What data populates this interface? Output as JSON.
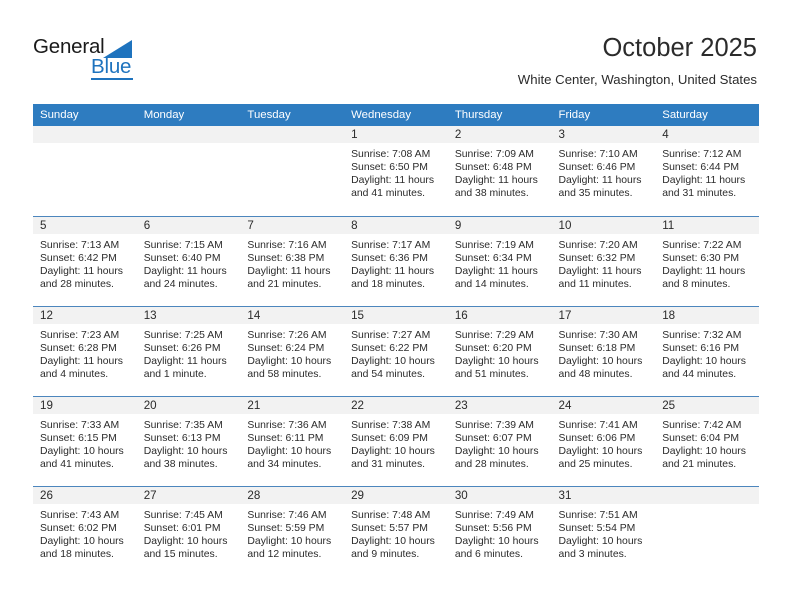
{
  "logo": {
    "word_one": "General",
    "word_two": "Blue",
    "triangle_color": "#1e73be"
  },
  "header": {
    "title": "October 2025",
    "subtitle": "White Center, Washington, United States",
    "accent_color": "#2e7cc0",
    "day_band_color": "#f2f2f2",
    "grid_rule_color": "#4c86bd"
  },
  "calendar": {
    "weekday_headers": [
      "Sunday",
      "Monday",
      "Tuesday",
      "Wednesday",
      "Thursday",
      "Friday",
      "Saturday"
    ],
    "labels": {
      "sunrise": "Sunrise:",
      "sunset": "Sunset:",
      "daylight": "Daylight:"
    },
    "weeks": [
      [
        {
          "day": "",
          "sunrise": "",
          "sunset": "",
          "daylight": "",
          "empty": true
        },
        {
          "day": "",
          "sunrise": "",
          "sunset": "",
          "daylight": "",
          "empty": true
        },
        {
          "day": "",
          "sunrise": "",
          "sunset": "",
          "daylight": "",
          "empty": true
        },
        {
          "day": "1",
          "sunrise": "Sunrise: 7:08 AM",
          "sunset": "Sunset: 6:50 PM",
          "daylight": "Daylight: 11 hours and 41 minutes."
        },
        {
          "day": "2",
          "sunrise": "Sunrise: 7:09 AM",
          "sunset": "Sunset: 6:48 PM",
          "daylight": "Daylight: 11 hours and 38 minutes."
        },
        {
          "day": "3",
          "sunrise": "Sunrise: 7:10 AM",
          "sunset": "Sunset: 6:46 PM",
          "daylight": "Daylight: 11 hours and 35 minutes."
        },
        {
          "day": "4",
          "sunrise": "Sunrise: 7:12 AM",
          "sunset": "Sunset: 6:44 PM",
          "daylight": "Daylight: 11 hours and 31 minutes."
        }
      ],
      [
        {
          "day": "5",
          "sunrise": "Sunrise: 7:13 AM",
          "sunset": "Sunset: 6:42 PM",
          "daylight": "Daylight: 11 hours and 28 minutes."
        },
        {
          "day": "6",
          "sunrise": "Sunrise: 7:15 AM",
          "sunset": "Sunset: 6:40 PM",
          "daylight": "Daylight: 11 hours and 24 minutes."
        },
        {
          "day": "7",
          "sunrise": "Sunrise: 7:16 AM",
          "sunset": "Sunset: 6:38 PM",
          "daylight": "Daylight: 11 hours and 21 minutes."
        },
        {
          "day": "8",
          "sunrise": "Sunrise: 7:17 AM",
          "sunset": "Sunset: 6:36 PM",
          "daylight": "Daylight: 11 hours and 18 minutes."
        },
        {
          "day": "9",
          "sunrise": "Sunrise: 7:19 AM",
          "sunset": "Sunset: 6:34 PM",
          "daylight": "Daylight: 11 hours and 14 minutes."
        },
        {
          "day": "10",
          "sunrise": "Sunrise: 7:20 AM",
          "sunset": "Sunset: 6:32 PM",
          "daylight": "Daylight: 11 hours and 11 minutes."
        },
        {
          "day": "11",
          "sunrise": "Sunrise: 7:22 AM",
          "sunset": "Sunset: 6:30 PM",
          "daylight": "Daylight: 11 hours and 8 minutes."
        }
      ],
      [
        {
          "day": "12",
          "sunrise": "Sunrise: 7:23 AM",
          "sunset": "Sunset: 6:28 PM",
          "daylight": "Daylight: 11 hours and 4 minutes."
        },
        {
          "day": "13",
          "sunrise": "Sunrise: 7:25 AM",
          "sunset": "Sunset: 6:26 PM",
          "daylight": "Daylight: 11 hours and 1 minute."
        },
        {
          "day": "14",
          "sunrise": "Sunrise: 7:26 AM",
          "sunset": "Sunset: 6:24 PM",
          "daylight": "Daylight: 10 hours and 58 minutes."
        },
        {
          "day": "15",
          "sunrise": "Sunrise: 7:27 AM",
          "sunset": "Sunset: 6:22 PM",
          "daylight": "Daylight: 10 hours and 54 minutes."
        },
        {
          "day": "16",
          "sunrise": "Sunrise: 7:29 AM",
          "sunset": "Sunset: 6:20 PM",
          "daylight": "Daylight: 10 hours and 51 minutes."
        },
        {
          "day": "17",
          "sunrise": "Sunrise: 7:30 AM",
          "sunset": "Sunset: 6:18 PM",
          "daylight": "Daylight: 10 hours and 48 minutes."
        },
        {
          "day": "18",
          "sunrise": "Sunrise: 7:32 AM",
          "sunset": "Sunset: 6:16 PM",
          "daylight": "Daylight: 10 hours and 44 minutes."
        }
      ],
      [
        {
          "day": "19",
          "sunrise": "Sunrise: 7:33 AM",
          "sunset": "Sunset: 6:15 PM",
          "daylight": "Daylight: 10 hours and 41 minutes."
        },
        {
          "day": "20",
          "sunrise": "Sunrise: 7:35 AM",
          "sunset": "Sunset: 6:13 PM",
          "daylight": "Daylight: 10 hours and 38 minutes."
        },
        {
          "day": "21",
          "sunrise": "Sunrise: 7:36 AM",
          "sunset": "Sunset: 6:11 PM",
          "daylight": "Daylight: 10 hours and 34 minutes."
        },
        {
          "day": "22",
          "sunrise": "Sunrise: 7:38 AM",
          "sunset": "Sunset: 6:09 PM",
          "daylight": "Daylight: 10 hours and 31 minutes."
        },
        {
          "day": "23",
          "sunrise": "Sunrise: 7:39 AM",
          "sunset": "Sunset: 6:07 PM",
          "daylight": "Daylight: 10 hours and 28 minutes."
        },
        {
          "day": "24",
          "sunrise": "Sunrise: 7:41 AM",
          "sunset": "Sunset: 6:06 PM",
          "daylight": "Daylight: 10 hours and 25 minutes."
        },
        {
          "day": "25",
          "sunrise": "Sunrise: 7:42 AM",
          "sunset": "Sunset: 6:04 PM",
          "daylight": "Daylight: 10 hours and 21 minutes."
        }
      ],
      [
        {
          "day": "26",
          "sunrise": "Sunrise: 7:43 AM",
          "sunset": "Sunset: 6:02 PM",
          "daylight": "Daylight: 10 hours and 18 minutes."
        },
        {
          "day": "27",
          "sunrise": "Sunrise: 7:45 AM",
          "sunset": "Sunset: 6:01 PM",
          "daylight": "Daylight: 10 hours and 15 minutes."
        },
        {
          "day": "28",
          "sunrise": "Sunrise: 7:46 AM",
          "sunset": "Sunset: 5:59 PM",
          "daylight": "Daylight: 10 hours and 12 minutes."
        },
        {
          "day": "29",
          "sunrise": "Sunrise: 7:48 AM",
          "sunset": "Sunset: 5:57 PM",
          "daylight": "Daylight: 10 hours and 9 minutes."
        },
        {
          "day": "30",
          "sunrise": "Sunrise: 7:49 AM",
          "sunset": "Sunset: 5:56 PM",
          "daylight": "Daylight: 10 hours and 6 minutes."
        },
        {
          "day": "31",
          "sunrise": "Sunrise: 7:51 AM",
          "sunset": "Sunset: 5:54 PM",
          "daylight": "Daylight: 10 hours and 3 minutes."
        },
        {
          "day": "",
          "sunrise": "",
          "sunset": "",
          "daylight": "",
          "empty": true
        }
      ]
    ]
  }
}
